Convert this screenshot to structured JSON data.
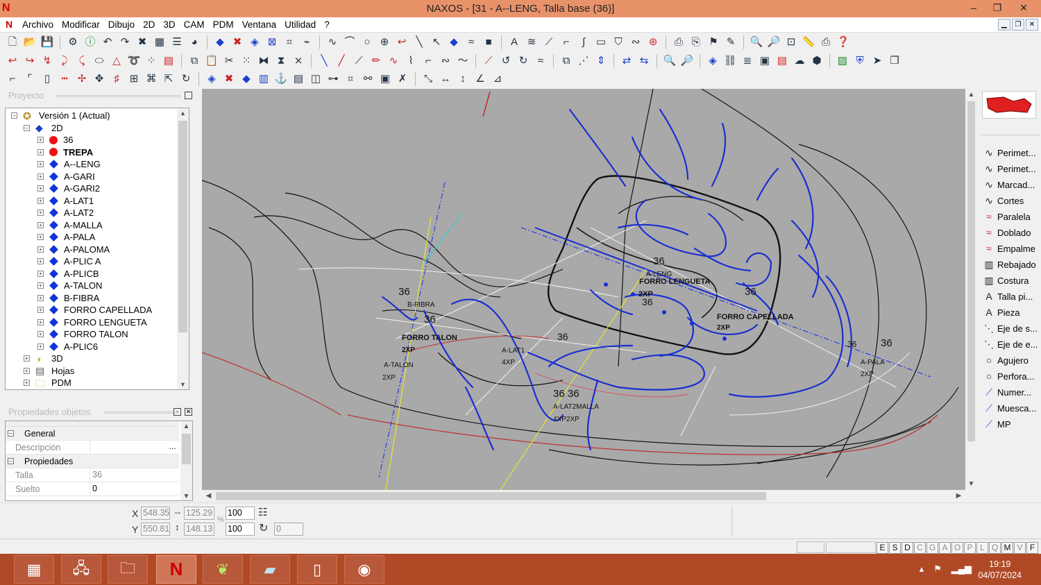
{
  "window": {
    "app_logo": "N",
    "title": "NAXOS - [31 - A--LENG, Talla base (36)]",
    "controls": [
      "–",
      "❐",
      "✕"
    ]
  },
  "menu": {
    "items": [
      "Archivo",
      "Modificar",
      "Dibujo",
      "2D",
      "3D",
      "CAM",
      "PDM",
      "Ventana",
      "Utilidad",
      "?"
    ]
  },
  "project_panel": {
    "title": "Proyecto",
    "tree": [
      {
        "label": "Versión 1 (Actual)",
        "level": 0,
        "icon": "version-icon"
      },
      {
        "label": "2D",
        "level": 1,
        "icon": "2d-icon"
      },
      {
        "label": "36",
        "level": 2,
        "icon": "red-dot-icon"
      },
      {
        "label": "TREPA",
        "level": 2,
        "icon": "red-dot-icon",
        "bold": true
      },
      {
        "label": "A--LENG",
        "level": 2,
        "icon": "blue-diamond-icon"
      },
      {
        "label": "A-GARI",
        "level": 2,
        "icon": "blue-diamond-icon"
      },
      {
        "label": "A-GARI2",
        "level": 2,
        "icon": "blue-diamond-icon"
      },
      {
        "label": "A-LAT1",
        "level": 2,
        "icon": "blue-diamond-icon"
      },
      {
        "label": "A-LAT2",
        "level": 2,
        "icon": "blue-diamond-icon"
      },
      {
        "label": "A-MALLA",
        "level": 2,
        "icon": "blue-diamond-icon"
      },
      {
        "label": "A-PALA",
        "level": 2,
        "icon": "blue-diamond-icon"
      },
      {
        "label": "A-PALOMA",
        "level": 2,
        "icon": "blue-diamond-icon"
      },
      {
        "label": "A-PLIC A",
        "level": 2,
        "icon": "blue-diamond-icon"
      },
      {
        "label": "A-PLICB",
        "level": 2,
        "icon": "blue-diamond-icon"
      },
      {
        "label": "A-TALON",
        "level": 2,
        "icon": "blue-diamond-icon"
      },
      {
        "label": "B-FIBRA",
        "level": 2,
        "icon": "blue-diamond-icon"
      },
      {
        "label": "FORRO CAPELLADA",
        "level": 2,
        "icon": "blue-diamond-icon"
      },
      {
        "label": "FORRO LENGUETA",
        "level": 2,
        "icon": "blue-diamond-icon"
      },
      {
        "label": "FORRO TALON",
        "level": 2,
        "icon": "blue-diamond-icon"
      },
      {
        "label": "A-PLIC6",
        "level": 2,
        "icon": "blue-diamond-icon"
      },
      {
        "label": "3D",
        "level": 1,
        "icon": "3d-icon"
      },
      {
        "label": "Hojas",
        "level": 1,
        "icon": "sheets-icon"
      },
      {
        "label": "PDM",
        "level": 1,
        "icon": "folder-icon"
      }
    ]
  },
  "properties_panel": {
    "title": "Propiedades objetos",
    "rows": [
      {
        "type": "cat",
        "key": "General"
      },
      {
        "type": "row",
        "key": "Descripción",
        "value": ""
      },
      {
        "type": "cat",
        "key": "Propiedades"
      },
      {
        "type": "row",
        "key": "Talla",
        "value": "36"
      },
      {
        "type": "row",
        "key": "Suelto",
        "value": "0"
      }
    ]
  },
  "canvas": {
    "labels": [
      {
        "text": "36",
        "size": 15
      },
      {
        "text": "B-FIBRA",
        "size": 10
      },
      {
        "text": "36",
        "size": 15
      },
      {
        "text": "FORRO TALON",
        "size": 11,
        "bold": true
      },
      {
        "text": "2XP",
        "size": 10,
        "bold": true
      },
      {
        "text": "A-TALON",
        "size": 10
      },
      {
        "text": "2XP",
        "size": 10
      },
      {
        "text": "A-LAT1",
        "size": 10
      },
      {
        "text": "4XP",
        "size": 10
      },
      {
        "text": "36",
        "size": 14
      },
      {
        "text": "36 36",
        "size": 15
      },
      {
        "text": "A-LAT2MALLA",
        "size": 10
      },
      {
        "text": "4XP2XP",
        "size": 10
      },
      {
        "text": "36",
        "size": 15
      },
      {
        "text": "A-LENG",
        "size": 10
      },
      {
        "text": "FORRO LENGUETA",
        "size": 11,
        "bold": true
      },
      {
        "text": "2XP",
        "size": 11,
        "bold": true
      },
      {
        "text": "36",
        "size": 14
      },
      {
        "text": "36",
        "size": 15
      },
      {
        "text": "FORRO CAPELLADA",
        "size": 11,
        "bold": true
      },
      {
        "text": "2XP",
        "size": 10,
        "bold": true
      },
      {
        "text": "36",
        "size": 12
      },
      {
        "text": "36",
        "size": 15
      },
      {
        "text": "A-PALA",
        "size": 10
      },
      {
        "text": "2XP",
        "size": 10
      }
    ]
  },
  "right_panel": {
    "items": [
      {
        "label": "Perimet...",
        "icon": "curve-icon"
      },
      {
        "label": "Perimet...",
        "icon": "curve-icon"
      },
      {
        "label": "Marcad...",
        "icon": "curve-icon"
      },
      {
        "label": "Cortes",
        "icon": "curve-icon"
      },
      {
        "label": "Paralela",
        "icon": "parallel-icon"
      },
      {
        "label": "Doblado",
        "icon": "fold-icon"
      },
      {
        "label": "Empalme",
        "icon": "join-icon"
      },
      {
        "label": "Rebajado",
        "icon": "skive-icon"
      },
      {
        "label": "Costura",
        "icon": "stitch-icon"
      },
      {
        "label": "Talla pi...",
        "icon": "text-a-icon"
      },
      {
        "label": "Pieza",
        "icon": "text-a-icon"
      },
      {
        "label": "Eje de s...",
        "icon": "axis-icon"
      },
      {
        "label": "Eje de e...",
        "icon": "axis-icon"
      },
      {
        "label": "Agujero",
        "icon": "circle-icon"
      },
      {
        "label": "Perfora...",
        "icon": "circle-icon"
      },
      {
        "label": "Numer...",
        "icon": "pen-icon"
      },
      {
        "label": "Muesca...",
        "icon": "pen-icon"
      },
      {
        "label": "MP",
        "icon": "pen-icon"
      }
    ]
  },
  "coords": {
    "x_label": "X",
    "y_label": "Y",
    "x": "548.35",
    "y": "550.81",
    "w": "125.29",
    "h": "148.13",
    "scale_x": "100",
    "scale_y": "100",
    "percent": "%",
    "rotation": "0"
  },
  "status": {
    "keys": [
      "E",
      "S",
      "D",
      "C",
      "G",
      "A",
      "O",
      "P",
      "L",
      "Q",
      "M",
      "V",
      "F"
    ],
    "active_keys": [
      "E",
      "S",
      "D",
      "M",
      "F"
    ]
  },
  "taskbar": {
    "time": "19:19",
    "date": "04/07/2024",
    "apps": [
      "calculator-icon",
      "network-icon",
      "file-explorer-icon",
      "naxos-icon",
      "design-app-icon",
      "notes-icon",
      "presentation-icon",
      "chrome-icon"
    ]
  },
  "colors": {
    "titlebar": "#e8926a",
    "canvas": "#a9a9a9",
    "taskbar": "#b04a26",
    "piece_blue": "#1a2fd0"
  }
}
